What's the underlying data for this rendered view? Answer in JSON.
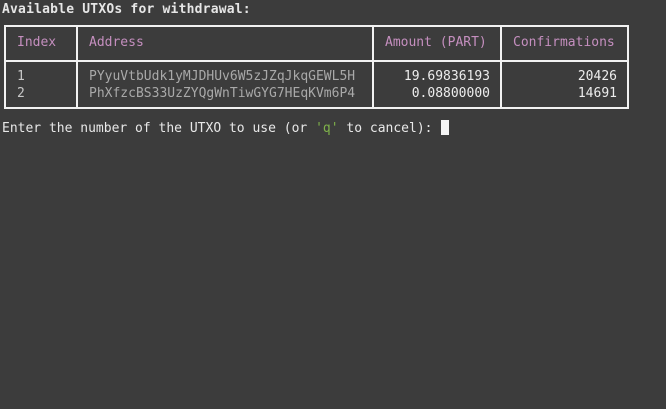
{
  "heading": "Available UTXOs for withdrawal:",
  "table": {
    "columns": [
      "Index",
      "Address",
      "Amount (PART)",
      "Confirmations"
    ],
    "rows": [
      {
        "index": "1",
        "address": "PYyuVtbUdk1yMJDHUv6W5zJZqJkqGEWL5H",
        "amount": "19.69836193",
        "confirmations": "20426"
      },
      {
        "index": "2",
        "address": "PhXfzcBS33UzZYQgWnTiwGYG7HEqKVm6P4",
        "amount": "0.08800000",
        "confirmations": "14691"
      }
    ]
  },
  "prompt": {
    "before": "Enter the number of the UTXO to use (or ",
    "key": "'q'",
    "after": " to cancel): "
  },
  "colors": {
    "background": "#3c3c3c",
    "header_text": "#c58fbf",
    "key_highlight": "#7fb24a"
  }
}
